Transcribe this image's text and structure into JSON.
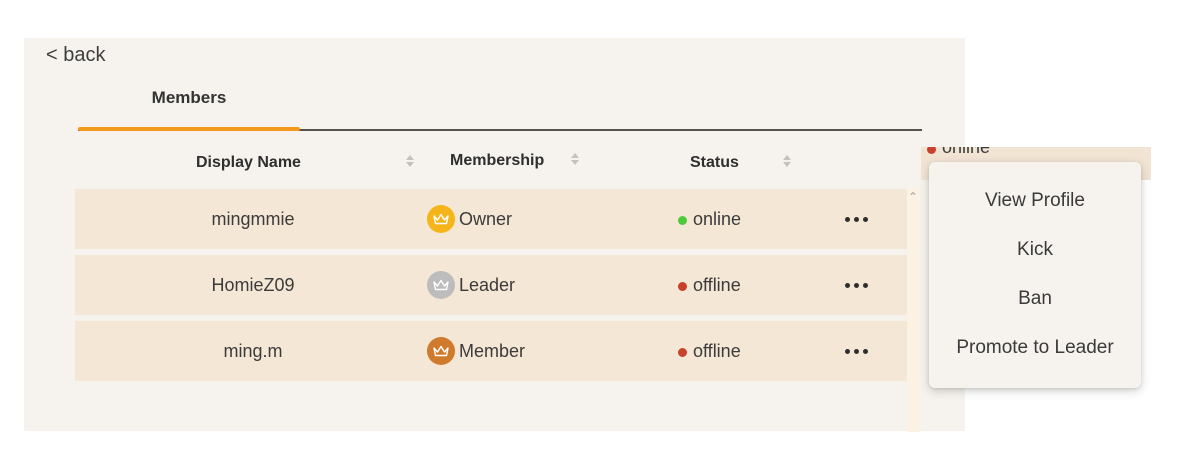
{
  "nav": {
    "back_label": "< back"
  },
  "tabs": [
    {
      "label": "Members",
      "active": true
    }
  ],
  "table": {
    "columns": [
      {
        "label": "Display Name",
        "sortable": true
      },
      {
        "label": "Membership",
        "sortable": true
      },
      {
        "label": "Status",
        "sortable": true
      }
    ],
    "rows": [
      {
        "name": "mingmmie",
        "role": "Owner",
        "role_icon": "crown-icon",
        "role_color": "#f5b51a",
        "status": "online",
        "status_color": "#4ccb3a",
        "more_label": "•••"
      },
      {
        "name": "HomieZ09",
        "role": "Leader",
        "role_icon": "crown-icon",
        "role_color": "#bdbcbc",
        "status": "offline",
        "status_color": "#c9412c",
        "more_label": "•••"
      },
      {
        "name": "ming.m",
        "role": "Member",
        "role_icon": "crown-icon",
        "role_color": "#cf7a2c",
        "status": "offline",
        "status_color": "#c9412c",
        "more_label": "•••"
      }
    ]
  },
  "background_row": {
    "status": "online",
    "status_color": "#c9412c"
  },
  "context_menu": {
    "items": [
      {
        "label": "View Profile"
      },
      {
        "label": "Kick"
      },
      {
        "label": "Ban"
      },
      {
        "label": "Promote to Leader"
      }
    ]
  },
  "colors": {
    "accent": "#f39a1e",
    "panel_bg": "#f6f3ee",
    "row_bg": "#f5e7d5"
  }
}
